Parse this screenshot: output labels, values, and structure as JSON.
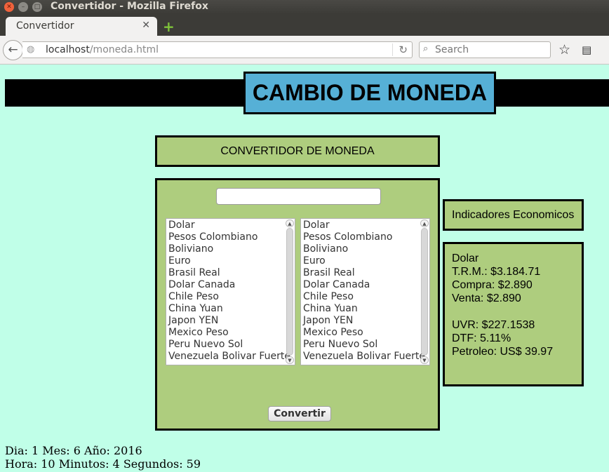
{
  "window": {
    "title": "Convertidor - Mozilla Firefox",
    "tab_title": "Convertidor",
    "url_host": "localhost",
    "url_path": "/moneda.html",
    "search_placeholder": "Search"
  },
  "page": {
    "header": "CAMBIO DE MONEDA",
    "subtitle": "CONVERTIDOR DE MONEDA",
    "amount_value": "",
    "currencies_from": [
      "Dolar",
      "Pesos Colombiano",
      "Boliviano",
      "Euro",
      "Brasil Real",
      "Dolar Canada",
      "Chile Peso",
      "China Yuan",
      "Japon YEN",
      "Mexico Peso",
      "Peru Nuevo Sol",
      "Venezuela Bolivar Fuerte"
    ],
    "currencies_to": [
      "Dolar",
      "Pesos Colombiano",
      "Boliviano",
      "Euro",
      "Brasil Real",
      "Dolar Canada",
      "Chile Peso",
      "China Yuan",
      "Japon YEN",
      "Mexico Peso",
      "Peru Nuevo Sol",
      "Venezuela Bolivar Fuerte"
    ],
    "convert_label": "Convertir",
    "indicators_title": "Indicadores Economicos",
    "indicators": {
      "currency": "Dolar",
      "trm": "T.R.M.: $3.184.71",
      "compra": "Compra: $2.890",
      "venta": "Venta: $2.890",
      "uvr": "UVR: $227.1538",
      "dtf": "DTF: 5.11%",
      "petroleo": "Petroleo: US$ 39.97"
    },
    "date_line": "Dia: 1 Mes: 6 Año: 2016",
    "time_line": "Hora: 10 Minutos: 4 Segundos: 59"
  },
  "colors": {
    "page_bg": "#c0ffe8",
    "header_bg": "#56b0d6",
    "panel_bg": "#aecd7e"
  }
}
